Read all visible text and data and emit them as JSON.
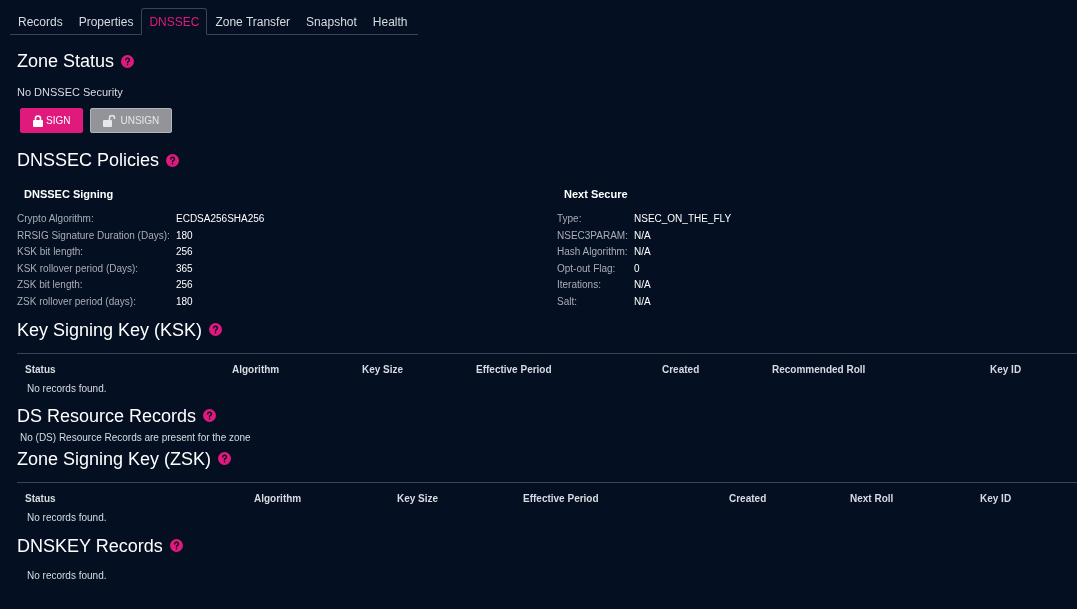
{
  "tabs": [
    {
      "label": "Records",
      "selected": false
    },
    {
      "label": "Properties",
      "selected": false
    },
    {
      "label": "DNSSEC",
      "selected": true
    },
    {
      "label": "Zone Transfer",
      "selected": false
    },
    {
      "label": "Snapshot",
      "selected": false
    },
    {
      "label": "Health",
      "selected": false
    }
  ],
  "zone_status": {
    "title": "Zone Status",
    "status": "No DNSSEC Security",
    "buttons": [
      {
        "label": "SIGN",
        "kind": "sign",
        "disabled": false
      },
      {
        "label": "UNSIGN",
        "kind": "unsign",
        "disabled": true
      }
    ]
  },
  "policies": {
    "title": "DNSSEC Policies",
    "groups": [
      {
        "title": "DNSSEC Signing",
        "rows": [
          {
            "label": "Crypto Algorithm:",
            "value": "ECDSA256SHA256"
          },
          {
            "label": "RRSIG Signature Duration (Days):",
            "value": "180"
          },
          {
            "label": "KSK bit length:",
            "value": "256"
          },
          {
            "label": "KSK rollover period (Days):",
            "value": "365"
          },
          {
            "label": "ZSK bit length:",
            "value": "256"
          },
          {
            "label": "ZSK rollover period (days):",
            "value": "180"
          }
        ]
      },
      {
        "title": "Next Secure",
        "rows": [
          {
            "label": "Type:",
            "value": "NSEC_ON_THE_FLY"
          },
          {
            "label": "NSEC3PARAM:",
            "value": "N/A"
          },
          {
            "label": "Hash Algorithm:",
            "value": "N/A"
          },
          {
            "label": "Opt-out Flag:",
            "value": "0"
          },
          {
            "label": "Iterations:",
            "value": "N/A"
          },
          {
            "label": "Salt:",
            "value": "N/A"
          }
        ]
      }
    ]
  },
  "ksk": {
    "title": "Key Signing Key (KSK)",
    "columns": [
      "Status",
      "Algorithm",
      "Key Size",
      "Effective Period",
      "Created",
      "Recommended Roll",
      "Key ID"
    ],
    "empty": "No records found."
  },
  "ds": {
    "title": "DS Resource Records",
    "message": "No (DS) Resource Records are present for the zone"
  },
  "zsk": {
    "title": "Zone Signing Key (ZSK)",
    "columns": [
      "Status",
      "Algorithm",
      "Key Size",
      "Effective Period",
      "Created",
      "Next Roll",
      "Key ID"
    ],
    "empty": "No records found."
  },
  "dnskey": {
    "title": "DNSKEY Records",
    "empty": "No records found."
  }
}
